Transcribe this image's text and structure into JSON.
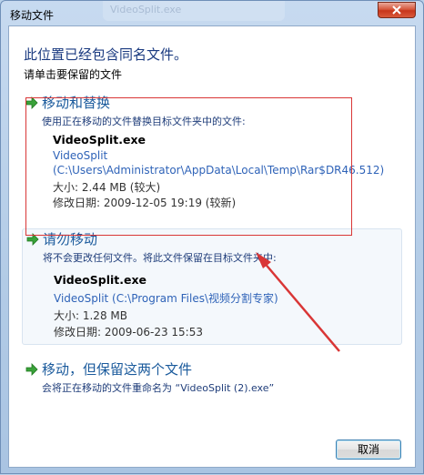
{
  "window": {
    "title": "移动文件",
    "ghost_tab": "VideoSplit.exe"
  },
  "dialog": {
    "heading": "此位置已经包含同名文件。",
    "subheading": "请单击要保留的文件"
  },
  "options": [
    {
      "title": "移动和替换",
      "description": "使用正在移动的文件替换目标文件夹中的文件:",
      "file": {
        "name": "VideoSplit.exe",
        "link_line1": "VideoSplit",
        "link_line2": "(C:\\Users\\Administrator\\AppData\\Local\\Temp\\Rar$DR46.512)",
        "size": "大小: 2.44 MB (较大)",
        "modified": "修改日期: 2009-12-05 19:19 (较新)"
      }
    },
    {
      "title": "请勿移动",
      "description": "将不会更改任何文件。将此文件保留在目标文件夹中:",
      "file": {
        "name": "VideoSplit.exe",
        "link_line1": "VideoSplit (C:\\Program Files\\视频分割专家)",
        "size": "大小: 1.28 MB",
        "modified": "修改日期: 2009-06-23 15:53"
      }
    },
    {
      "title": "移动，但保留这两个文件",
      "description": "会将正在移动的文件重命名为 “VideoSplit (2).exe”"
    }
  ],
  "buttons": {
    "cancel": "取消"
  },
  "colors": {
    "option_title": "#1a5a9c",
    "link": "#2f63b8",
    "annotation": "#d93636",
    "arrow_icon": "#3aa23a"
  },
  "icons": {
    "option_arrow": "green-arrow-icon",
    "close": "close-icon"
  }
}
